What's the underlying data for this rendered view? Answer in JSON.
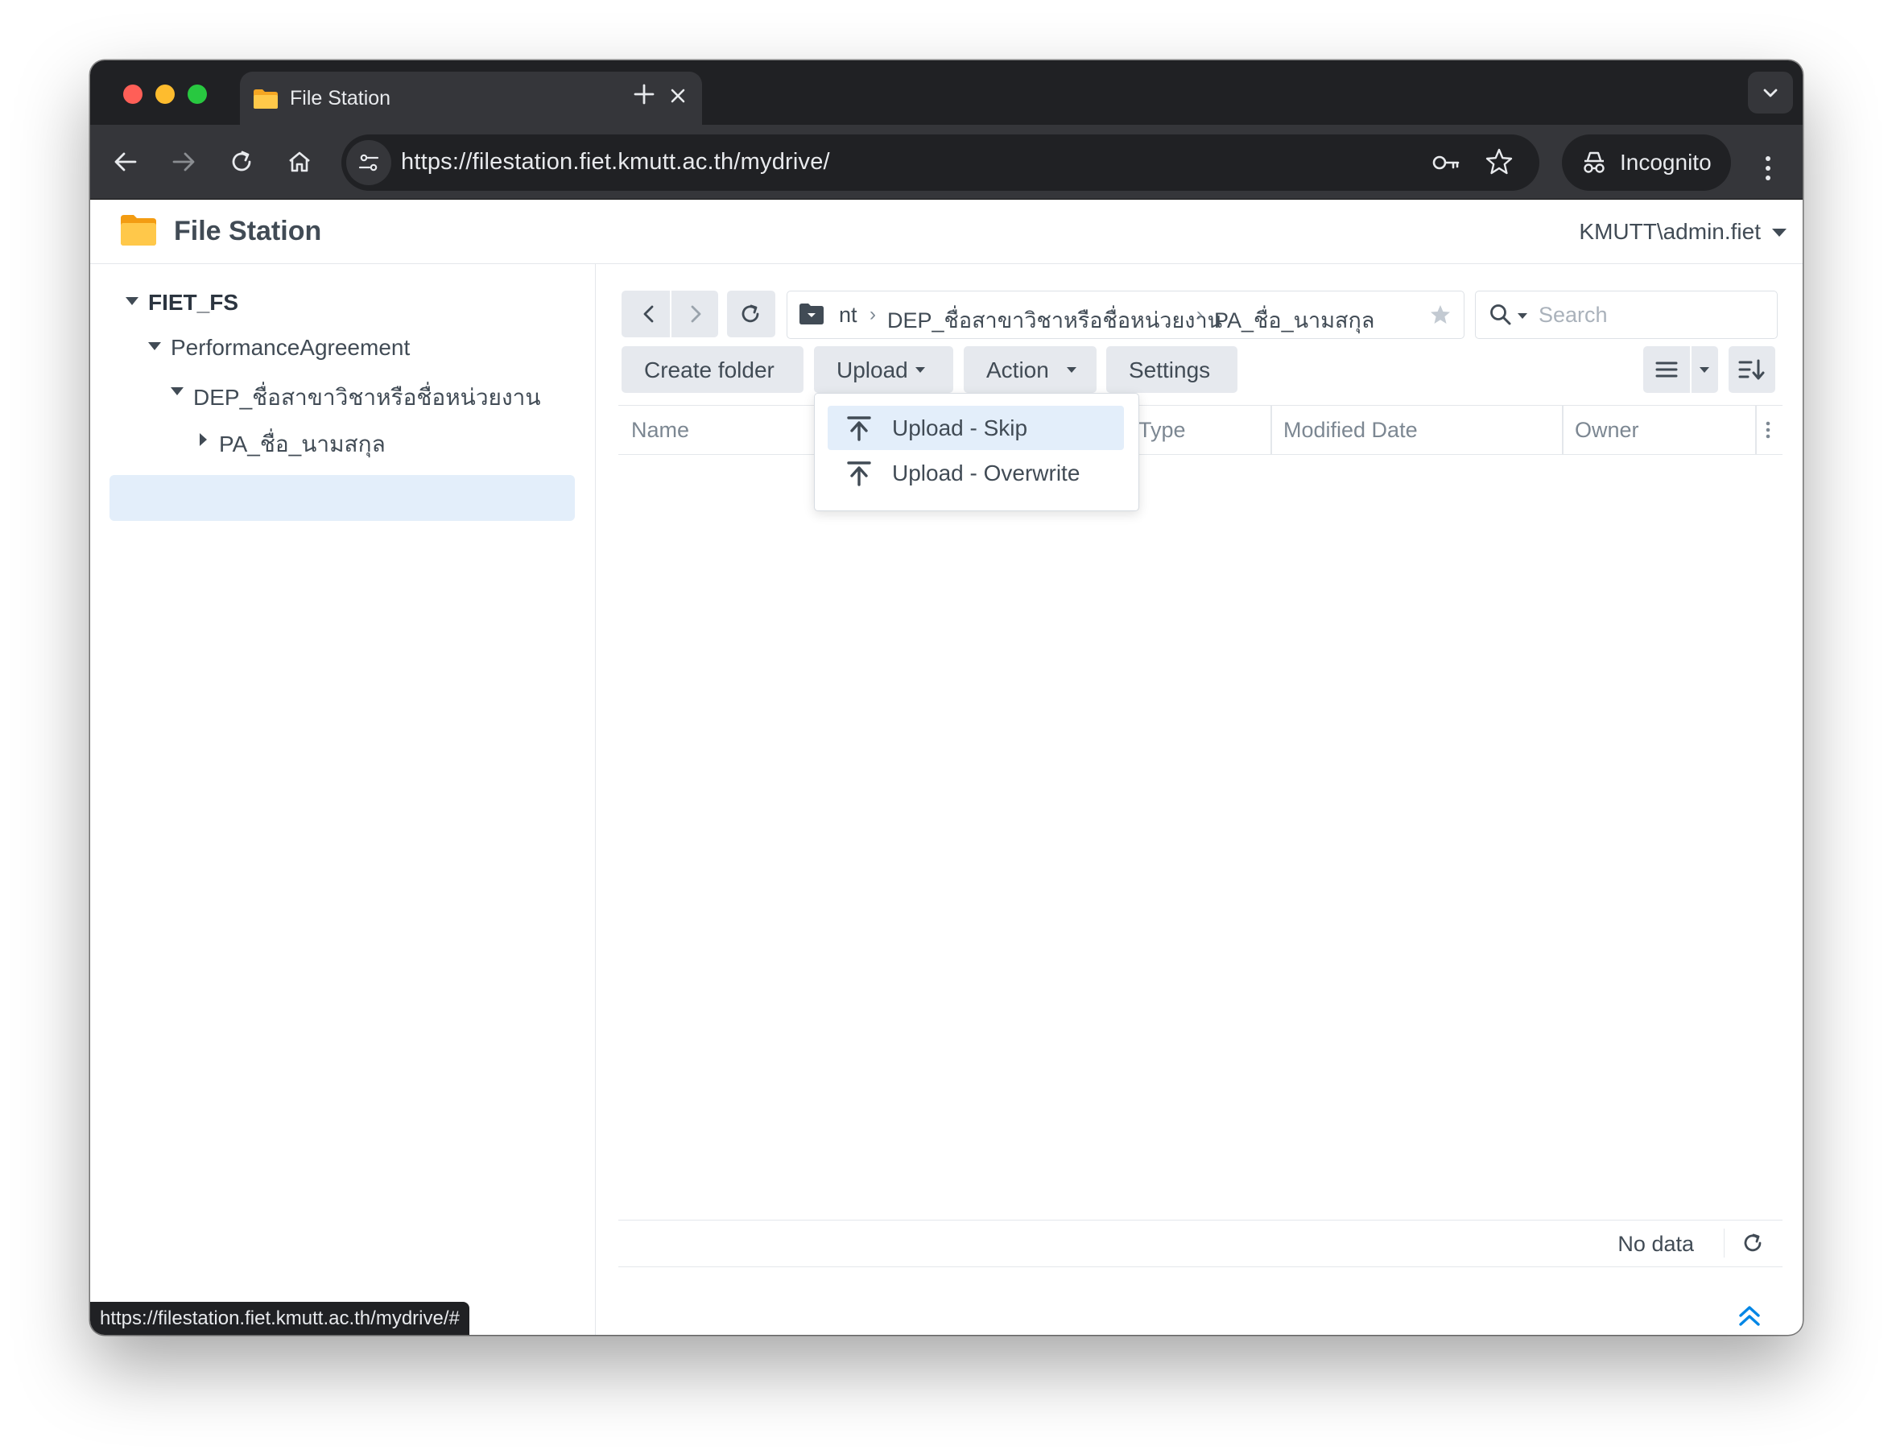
{
  "browser": {
    "tab_title": "File Station",
    "url": "https://filestation.fiet.kmutt.ac.th/mydrive/",
    "profile_label": "Incognito",
    "status_url": "https://filestation.fiet.kmutt.ac.th/mydrive/#"
  },
  "app": {
    "title": "File Station",
    "user": "KMUTT\\admin.fiet"
  },
  "tree": {
    "root": "FIET_FS",
    "level1": "PerformanceAgreement",
    "level2": "DEP_ชื่อสาขาวิชาหรือชื่อหน่วยงาน",
    "level3": "PA_ชื่อ_นามสกุล"
  },
  "path": {
    "segments": [
      "nt",
      "DEP_ชื่อสาขาวิชาหรือชื่อหน่วยงาน",
      "PA_ชื่อ_นามสกุล"
    ],
    "search_placeholder": "Search"
  },
  "toolbar": {
    "create_folder": "Create folder",
    "upload": "Upload",
    "action": "Action",
    "settings": "Settings"
  },
  "upload_menu": {
    "items": [
      "Upload - Skip",
      "Upload - Overwrite"
    ],
    "highlighted_index": 0
  },
  "columns": {
    "name": "Name",
    "type": "Type",
    "modified": "Modified Date",
    "owner": "Owner"
  },
  "footer": {
    "status": "No data"
  },
  "colors": {
    "accent": "#0086e5",
    "selection": "#e3eefa",
    "text": "#414b55",
    "chrome_dark": "#202124"
  }
}
